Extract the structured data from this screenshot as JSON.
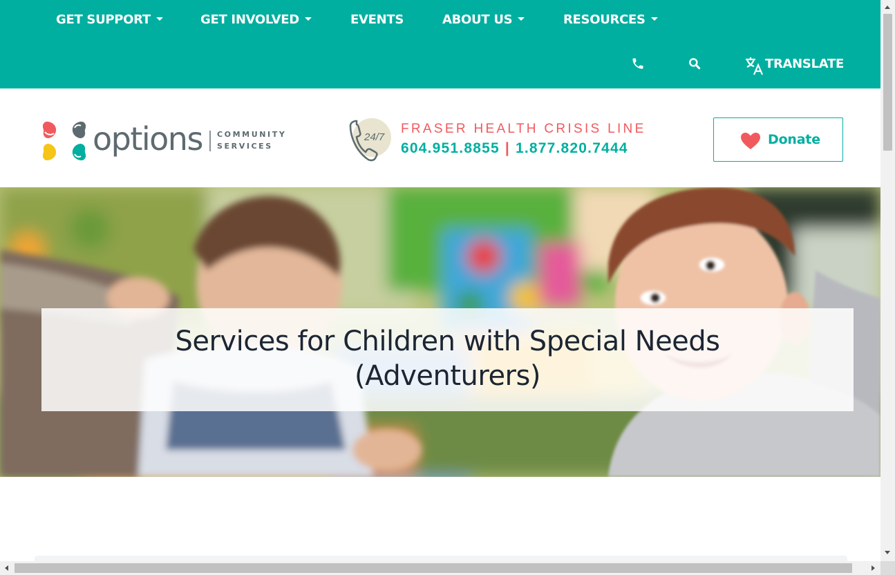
{
  "nav": {
    "items": [
      {
        "label": "GET SUPPORT",
        "has_dropdown": true
      },
      {
        "label": "GET INVOLVED",
        "has_dropdown": true
      },
      {
        "label": "EVENTS",
        "has_dropdown": false
      },
      {
        "label": "ABOUT US",
        "has_dropdown": true
      },
      {
        "label": "RESOURCES",
        "has_dropdown": true
      }
    ]
  },
  "utility": {
    "phone_icon": "phone-icon",
    "search_icon": "search-icon",
    "translate_icon": "translate-icon",
    "translate_label": "TRANSLATE"
  },
  "header": {
    "logo": {
      "word": "options",
      "sub_line1": "COMMUNITY",
      "sub_line2": "SERVICES"
    },
    "crisis": {
      "badge": "24/7",
      "title": "FRASER HEALTH CRISIS LINE",
      "phone1": "604.951.8855",
      "separator": "|",
      "phone2": "1.877.820.7444"
    },
    "donate": {
      "label": "Donate",
      "icon": "heart-icon"
    }
  },
  "hero": {
    "title_line1": "Services for Children with Special Needs",
    "title_line2": "(Adventurers)"
  },
  "colors": {
    "brand_teal": "#00afa0",
    "accent_coral": "#f05a5e",
    "heading_dark": "#1c2533"
  }
}
